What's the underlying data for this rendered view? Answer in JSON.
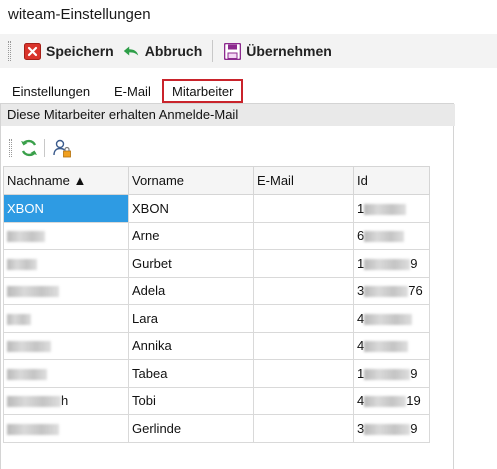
{
  "window": {
    "title": "witeam-Einstellungen"
  },
  "toolbar": {
    "save_label": "Speichern",
    "cancel_label": "Abbruch",
    "apply_label": "Übernehmen",
    "icons": {
      "save": "red-x-save-icon",
      "cancel": "green-undo-icon",
      "apply": "purple-floppy-icon"
    }
  },
  "tabs": [
    {
      "label": "Einstellungen",
      "active": false
    },
    {
      "label": "E-Mail",
      "active": false
    },
    {
      "label": "Mitarbeiter",
      "active": true
    }
  ],
  "panel": {
    "info_text": "Diese Mitarbeiter erhalten Anmelde-Mail",
    "subtoolbar": {
      "icons": [
        "refresh-icon",
        "user-lock-icon"
      ]
    }
  },
  "table": {
    "columns": [
      "Nachname ▲",
      "Vorname",
      "E-Mail",
      "Id"
    ],
    "rows": [
      {
        "nachname": "XBON",
        "vorname": "XBON",
        "email": "",
        "id_prefix": "1",
        "id_suffix": ""
      },
      {
        "nachname": "",
        "vorname": "Arne",
        "email": "",
        "id_prefix": "6",
        "id_suffix": ""
      },
      {
        "nachname": "",
        "vorname": "Gurbet",
        "email": "",
        "id_prefix": "1",
        "id_suffix": "9"
      },
      {
        "nachname": "",
        "vorname": "Adela",
        "email": "",
        "id_prefix": "3",
        "id_suffix": "76"
      },
      {
        "nachname": "",
        "vorname": "Lara",
        "email": "",
        "id_prefix": "4",
        "id_suffix": ""
      },
      {
        "nachname": "",
        "vorname": "Annika",
        "email": "",
        "id_prefix": "4",
        "id_suffix": ""
      },
      {
        "nachname": "",
        "vorname": "Tabea",
        "email": "",
        "id_prefix": "1",
        "id_suffix": "9"
      },
      {
        "nachname": "h",
        "vorname": "Tobi",
        "email": "",
        "id_prefix": "4",
        "id_suffix": "19"
      },
      {
        "nachname": "",
        "vorname": "Gerlinde",
        "email": "",
        "id_prefix": "3",
        "id_suffix": "9"
      }
    ]
  },
  "colors": {
    "accent_tab_border": "#c9232b",
    "selection": "#2e9be3"
  }
}
